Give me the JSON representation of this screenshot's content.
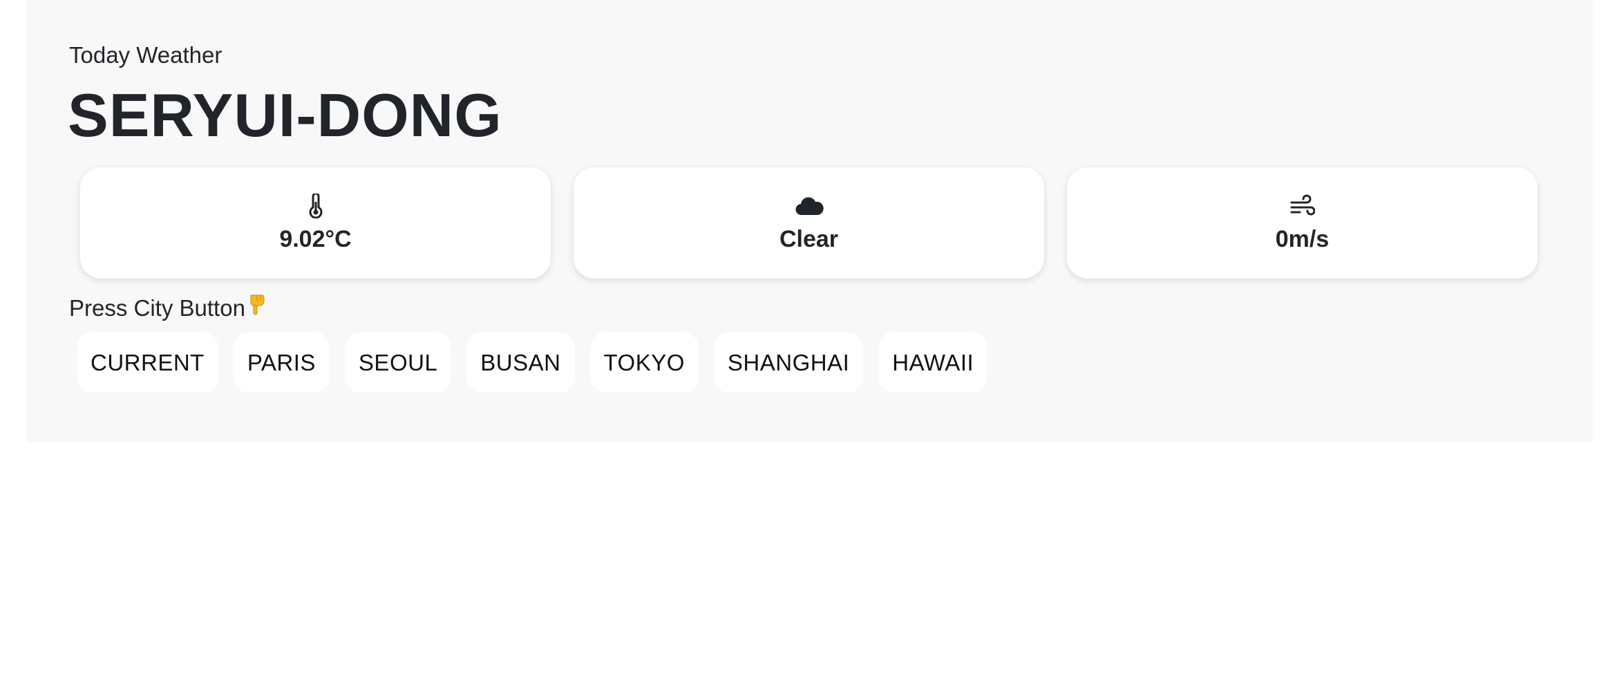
{
  "header": {
    "subtitle": "Today Weather",
    "city": "SERYUI-DONG"
  },
  "cards": [
    {
      "icon": "thermometer-icon",
      "value": "9.02°C"
    },
    {
      "icon": "cloud-icon",
      "value": "Clear"
    },
    {
      "icon": "wind-icon",
      "value": "0m/s"
    }
  ],
  "hint": {
    "text": "Press City Button",
    "icon": "pointing-down-hand-icon"
  },
  "city_buttons": [
    "CURRENT",
    "PARIS",
    "SEOUL",
    "BUSAN",
    "TOKYO",
    "SHANGHAI",
    "HAWAII"
  ],
  "colors": {
    "panel_background": "#f8f8f8",
    "card_background": "#ffffff",
    "text": "#212529",
    "hand": "#f5b921"
  }
}
